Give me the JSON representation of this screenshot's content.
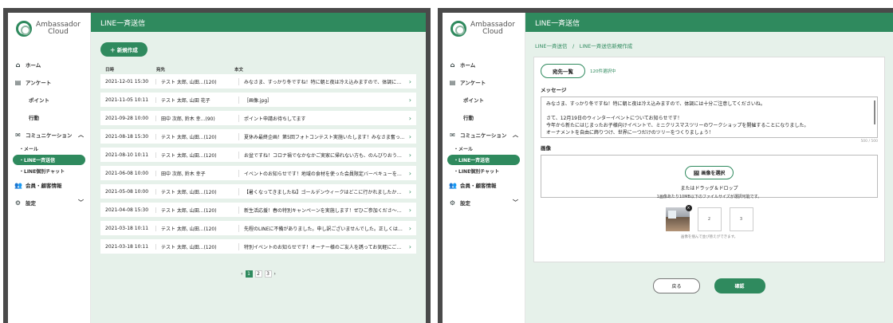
{
  "brand": {
    "logo_line1": "Ambassador",
    "logo_line2": "Cloud"
  },
  "sidebar": {
    "home": "ホーム",
    "survey": "アンケート",
    "point": "ポイント",
    "action": "行動",
    "communication": "コミュニケーション",
    "mail": "・メール",
    "line_bulk": "・LINE一斉送信",
    "line_individual": "・LINE個別チャット",
    "members": "会員・顧客情報",
    "settings": "設定"
  },
  "list_screen": {
    "title": "LINE一斉送信",
    "new_button": "＋ 新規作成",
    "columns": {
      "date": "日時",
      "to": "宛先",
      "body": "本文"
    },
    "rows": [
      {
        "date": "2021-12-01 15:30",
        "to": "テスト 太郎, 山田...(120)",
        "body": "みなさま、すっかり冬ですね！特に朝と夜は冷え込みますので、体調には..."
      },
      {
        "date": "2021-11-05 10:11",
        "to": "テスト 太郎, 山田 花子",
        "body": "［画像.jpg］"
      },
      {
        "date": "2021-09-28 10:00",
        "to": "田中 次郎, 鈴木 幸...(90)",
        "body": "ポイント申請お待ちしてます"
      },
      {
        "date": "2021-08-18 15:30",
        "to": "テスト 太郎, 山田...(120)",
        "body": "夏休み最終企画！第5回フォトコンテスト実施いたします！みなさま奮っ..."
      },
      {
        "date": "2021-08-10 10:11",
        "to": "テスト 太郎, 山田...(120)",
        "body": "お盆ですね！コロナ禍でなかなかご実家に帰れない方も、のんびりおうち..."
      },
      {
        "date": "2021-06-08 10:00",
        "to": "田中 次郎, 鈴木 幸子",
        "body": "イベントのお知らせです！地域の食材を使った会員限定バーベキューを開催..."
      },
      {
        "date": "2021-05-08 10:00",
        "to": "テスト 太郎, 山田...(120)",
        "body": "【暑くなってきましたね】ゴールデンウィークはどこに行かれましたか？..."
      },
      {
        "date": "2021-04-08 15:30",
        "to": "テスト 太郎, 山田...(120)",
        "body": "新生活応援！春の特別キャンペーンを実施します！ぜひご参加くださ〜い..."
      },
      {
        "date": "2021-03-18 10:11",
        "to": "テスト 太郎, 山田...(120)",
        "body": "先程のLINEに不備がありました。申し訳ございませんでした。正しくは、..."
      },
      {
        "date": "2021-03-18 10:11",
        "to": "テスト 太郎, 山田...(120)",
        "body": "特別イベントのお知らせです！オーナー様のご友人を誘ってお気軽にご参加..."
      }
    ],
    "pager": {
      "prev": "‹",
      "pages": [
        "1",
        "2",
        "3"
      ],
      "current": "1",
      "next": "›"
    }
  },
  "create_screen": {
    "title": "LINE一斉送信",
    "breadcrumb": "LINE一斉送信　/　LINE一斉送信新規作成",
    "recipients_button": "宛先一覧",
    "selected_count": "120件選択中",
    "message_label": "メッセージ",
    "message_lines": [
      "みなさま、すっかり冬ですね！特に朝と夜は冷え込みますので、体調には十分ご注意してくださいね。",
      "",
      "さて、12月19日のウィンターイベントについてお知らせです！",
      "今年から新たにはじまったお子様向けイベントで、ミニクリスマスツリーのワークショップを開催することになりました。",
      "オーナメントを自由に飾りつけ、世界に一つだけのツリーをつくりましょう！"
    ],
    "char_counter": "500 / 500",
    "image_label": "画像",
    "select_image_button": "🖼 画像を選択",
    "drop_text": "またはドラッグ＆ドロップ",
    "drop_note": "1画像あたり10MB以下のファイルサイズが選択可能です。",
    "slots": [
      "2",
      "3"
    ],
    "remove_icon": "×",
    "reorder_hint": "画像を掴んで並び替えができます。",
    "back_button": "戻る",
    "confirm_button": "確認"
  }
}
